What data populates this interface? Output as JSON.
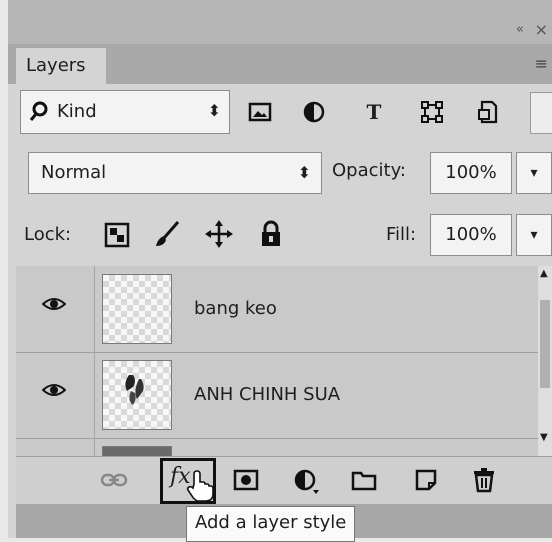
{
  "panel": {
    "collapse_glyph": "«",
    "close_glyph": "×",
    "tab_label": "Layers",
    "menu_glyph": "≡"
  },
  "filter": {
    "kind_label": "Kind",
    "type_glyph": "T"
  },
  "blend": {
    "mode": "Normal",
    "opacity_label": "Opacity:",
    "opacity_value": "100%"
  },
  "lock": {
    "label": "Lock:",
    "fill_label": "Fill:",
    "fill_value": "100%"
  },
  "layers": [
    {
      "name": "bang keo",
      "visible": true
    },
    {
      "name": "ANH CHINH SUA",
      "visible": true
    }
  ],
  "toolbar": {
    "fx_label": "fx"
  },
  "tooltip": "Add a layer style",
  "icons": [
    "search-icon",
    "image-filter-icon",
    "adjustment-filter-icon",
    "type-filter-icon",
    "shape-filter-icon",
    "smart-object-filter-icon",
    "lock-transparent-icon",
    "lock-brush-icon",
    "lock-move-icon",
    "lock-all-icon",
    "eye-icon",
    "link-icon",
    "mask-icon",
    "adjustment-icon",
    "folder-icon",
    "new-layer-icon",
    "trash-icon"
  ]
}
